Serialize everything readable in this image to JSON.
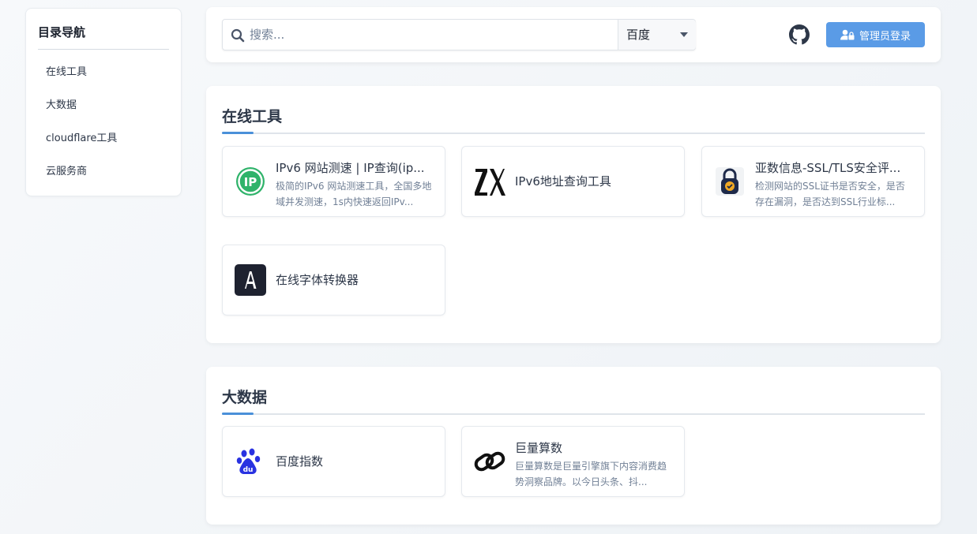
{
  "sidebar": {
    "title": "目录导航",
    "items": [
      {
        "label": "在线工具"
      },
      {
        "label": "大数据"
      },
      {
        "label": "cloudflare工具"
      },
      {
        "label": "云服务商"
      }
    ]
  },
  "header": {
    "search": {
      "placeholder": "搜索...",
      "value": ""
    },
    "engine": {
      "selected": "百度"
    },
    "github_icon": "github-icon",
    "admin_button": {
      "label": "管理员登录",
      "icon": "user-lock-icon",
      "color": "#5a9be6"
    }
  },
  "sections": [
    {
      "title": "在线工具",
      "cards": [
        {
          "title": "IPv6 网站测速 | IP查询(ip...",
          "desc": "极简的IPv6 网站测速工具，全国多地域并发测速，1s内快速返回IPv...",
          "icon": "ip-logo"
        },
        {
          "title": "IPv6地址查询工具",
          "desc": "",
          "icon": "zx-logo"
        },
        {
          "title": "亚数信息-SSL/TLS安全评...",
          "desc": "检测网站的SSL证书是否安全，是否存在漏洞，是否达到SSL行业标...",
          "icon": "ssl-lock-logo"
        },
        {
          "title": "在线字体转换器",
          "desc": "",
          "icon": "font-a-logo"
        }
      ]
    },
    {
      "title": "大数据",
      "cards": [
        {
          "title": "百度指数",
          "desc": "",
          "icon": "baidu-paw-logo"
        },
        {
          "title": "巨量算数",
          "desc": "巨量算数是巨量引擎旗下内容消费趋势洞察品牌。以今日头条、抖...",
          "icon": "chain-link-logo"
        }
      ]
    }
  ],
  "colors": {
    "accent": "#4a90d9",
    "button": "#5a9be6"
  }
}
